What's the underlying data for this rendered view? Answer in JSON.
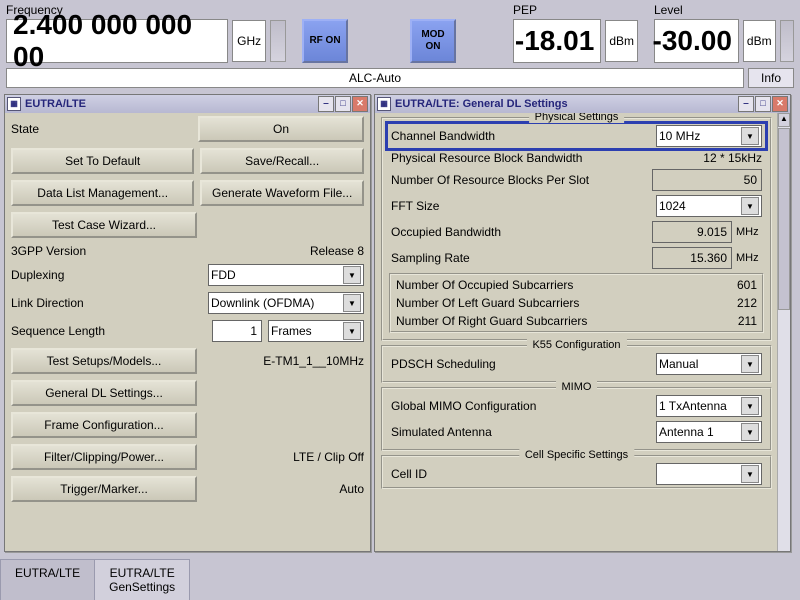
{
  "header": {
    "freq": {
      "label": "Frequency",
      "val": "2.400 000 000 00",
      "unit": "GHz"
    },
    "rf_btn": "RF ON",
    "mod_btn": "MOD\nON",
    "pep": {
      "label": "PEP",
      "val": "-18.01",
      "unit": "dBm"
    },
    "level": {
      "label": "Level",
      "val": "-30.00",
      "unit": "dBm"
    },
    "alc": "ALC-Auto",
    "info": "Info"
  },
  "win_left": {
    "title": "EUTRA/LTE",
    "state_label": "State",
    "state_val": "On",
    "b_default": "Set To Default",
    "b_save": "Save/Recall...",
    "b_datalist": "Data List Management...",
    "b_genwave": "Generate Waveform File...",
    "b_testcase": "Test Case Wizard...",
    "ver_label": "3GPP Version",
    "ver_val": "Release 8",
    "dup_label": "Duplexing",
    "dup_val": "FDD",
    "link_label": "Link Direction",
    "link_val": "Downlink (OFDMA)",
    "seq_label": "Sequence Length",
    "seq_val": "1",
    "seq_unit": "Frames",
    "b_test": "Test Setups/Models...",
    "test_val": "E-TM1_1__10MHz",
    "b_gendl": "General DL Settings...",
    "b_frame": "Frame Configuration...",
    "b_filter": "Filter/Clipping/Power...",
    "filter_val": "LTE / Clip Off",
    "b_trigger": "Trigger/Marker...",
    "trigger_val": "Auto"
  },
  "win_right": {
    "title": "EUTRA/LTE: General DL Settings",
    "phys": {
      "legend": "Physical Settings",
      "cb_label": "Channel Bandwidth",
      "cb_val": "10 MHz",
      "prb_label": "Physical Resource Block Bandwidth",
      "prb_val": "12 * 15kHz",
      "nrb_label": "Number Of Resource Blocks Per Slot",
      "nrb_val": "50",
      "fft_label": "FFT Size",
      "fft_val": "1024",
      "obw_label": "Occupied Bandwidth",
      "obw_val": "9.015",
      "obw_unit": "MHz",
      "sr_label": "Sampling Rate",
      "sr_val": "15.360",
      "sr_unit": "MHz",
      "noc_label": "Number Of Occupied Subcarriers",
      "noc_val": "601",
      "nlg_label": "Number Of Left Guard Subcarriers",
      "nlg_val": "212",
      "nrg_label": "Number Of Right Guard Subcarriers",
      "nrg_val": "211"
    },
    "k55": {
      "legend": "K55 Configuration",
      "ps_label": "PDSCH Scheduling",
      "ps_val": "Manual"
    },
    "mimo": {
      "legend": "MIMO",
      "gm_label": "Global MIMO Configuration",
      "gm_val": "1 TxAntenna",
      "sa_label": "Simulated Antenna",
      "sa_val": "Antenna 1"
    },
    "cell": {
      "legend": "Cell Specific Settings",
      "cid_label": "Cell ID"
    }
  },
  "tabs": {
    "t1": "EUTRA/LTE",
    "t2": "EUTRA/LTE\nGenSettings"
  }
}
